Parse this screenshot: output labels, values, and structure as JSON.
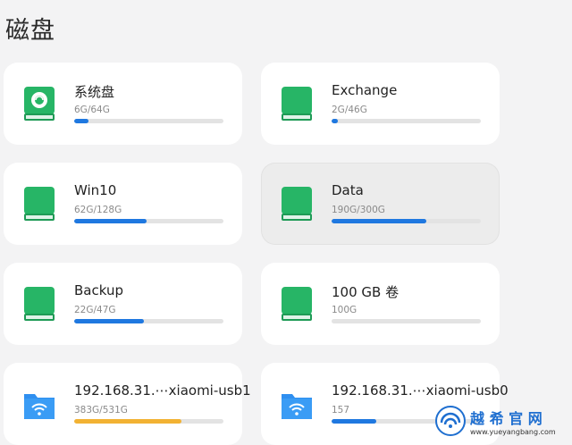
{
  "page_title": "磁盘",
  "colors": {
    "drive_green": "#27b566",
    "bar_blue": "#1f78e0",
    "bar_orange": "#f2b233",
    "track": "#e3e3e3",
    "folder_blue": "#2f8ff0"
  },
  "disks": [
    {
      "name": "系统盘",
      "usage": "6G/64G",
      "percent": 9.4,
      "icon": "system-drive-icon",
      "bar": "blue"
    },
    {
      "name": "Exchange",
      "usage": "2G/46G",
      "percent": 4.3,
      "icon": "drive-icon",
      "bar": "blue"
    },
    {
      "name": "Win10",
      "usage": "62G/128G",
      "percent": 48.4,
      "icon": "drive-icon",
      "bar": "blue"
    },
    {
      "name": "Data",
      "usage": "190G/300G",
      "percent": 63.3,
      "icon": "drive-icon",
      "bar": "blue",
      "selected": true
    },
    {
      "name": "Backup",
      "usage": "22G/47G",
      "percent": 46.8,
      "icon": "drive-icon",
      "bar": "blue"
    },
    {
      "name": "100 GB 卷",
      "usage": "100G",
      "percent": 0,
      "icon": "drive-icon",
      "bar": "blue"
    },
    {
      "name": "192.168.31.⋯xiaomi-usb1",
      "usage": "383G/531G",
      "percent": 72.1,
      "icon": "network-folder-icon",
      "bar": "orange"
    },
    {
      "name": "192.168.31.⋯xiaomi-usb0",
      "usage": "157",
      "percent": 30,
      "icon": "network-folder-icon",
      "bar": "blue"
    }
  ],
  "watermark": {
    "main": "越 希 官 网",
    "url": "www.yueyangbang.com"
  }
}
